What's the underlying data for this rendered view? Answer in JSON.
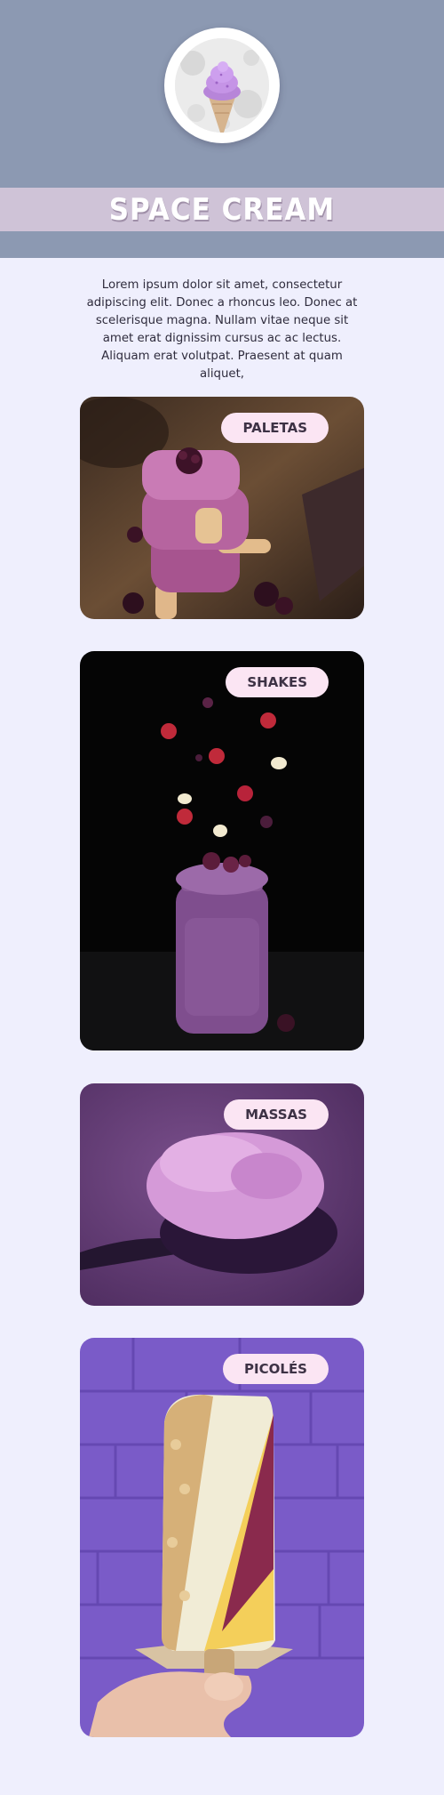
{
  "brand": {
    "title": "SPACE CREAM"
  },
  "intro": {
    "text": "Lorem ipsum dolor sit amet, consectetur adipiscing elit. Donec a rhoncus leo. Donec at scelerisque magna. Nullam vitae neque sit amet erat dignissim cursus ac ac lectus. Aliquam erat volutpat. Praesent at quam aliquet,"
  },
  "categories": [
    {
      "label": "PALETAS",
      "image": "purple-popsicles-photo"
    },
    {
      "label": "SHAKES",
      "image": "berry-milkshake-jar-photo"
    },
    {
      "label": "MASSAS",
      "image": "ice-cream-scoop-photo"
    },
    {
      "label": "PICOLÉS",
      "image": "hand-held-popsicle-photo"
    }
  ],
  "colors": {
    "header_bg": "#8c99b2",
    "banner_bg": "#cfc3d7",
    "page_bg": "#efeffd",
    "label_bg": "#fbe5f3"
  }
}
